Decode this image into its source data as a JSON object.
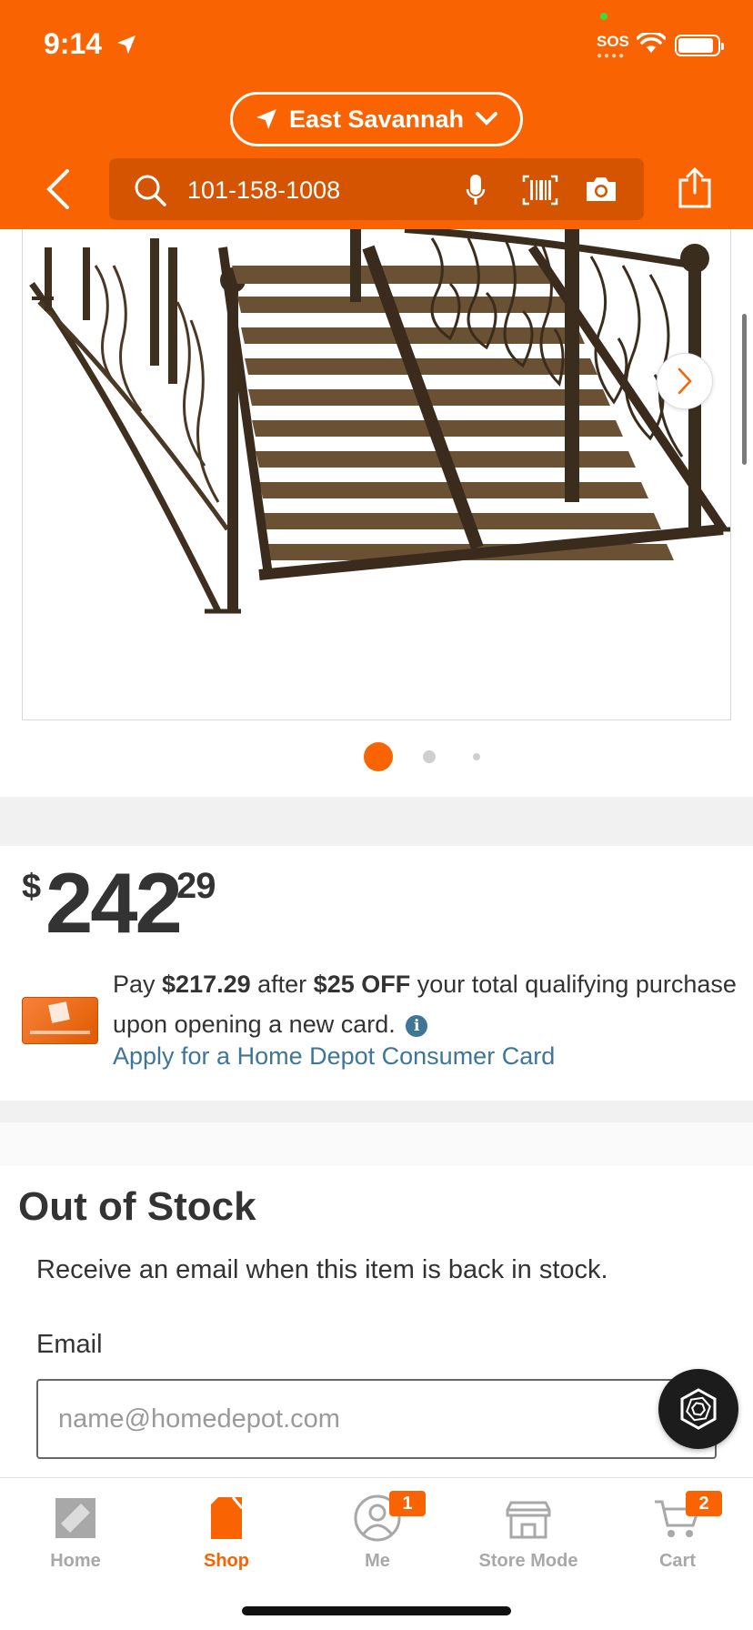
{
  "status_bar": {
    "time": "9:14",
    "sos": "SOS"
  },
  "header": {
    "store_name": "East Savannah",
    "search_query": "101-158-1008"
  },
  "product": {
    "image_icon": "garden-bridge-photo",
    "carousel_count": 3,
    "carousel_active_index": 0
  },
  "price": {
    "currency_symbol": "$",
    "dollars": "242",
    "cents": "29"
  },
  "promo": {
    "pay_prefix": "Pay ",
    "discounted_price": "$217.29",
    "after_text": " after ",
    "discount": "$25 OFF",
    "rest_line1": " your total qualifying purchase upon opening a new card.",
    "apply_link": "Apply for a Home Depot Consumer Card"
  },
  "stock": {
    "title": "Out of Stock",
    "description": "Receive an email when this item is back in stock.",
    "email_label": "Email",
    "email_placeholder": "name@homedepot.com"
  },
  "tabbar": {
    "home": "Home",
    "shop": "Shop",
    "me": "Me",
    "me_badge": "1",
    "store_mode": "Store Mode",
    "cart": "Cart",
    "cart_badge": "2"
  },
  "colors": {
    "brand_orange": "#f96302",
    "link_blue": "#3e7697",
    "text_dark": "#333333"
  }
}
